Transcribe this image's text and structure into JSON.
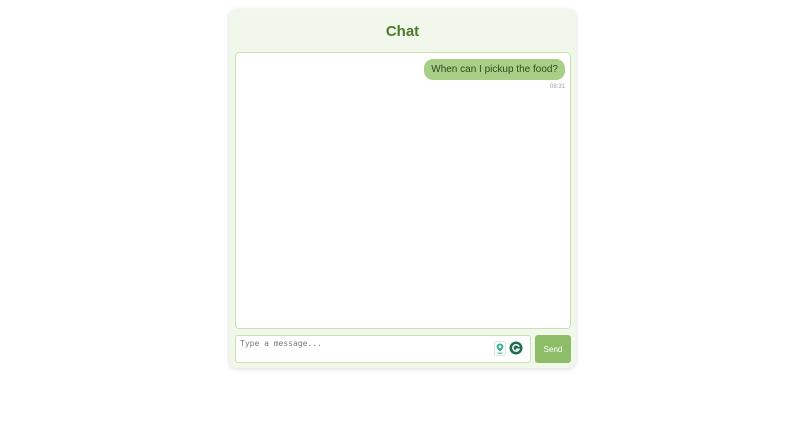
{
  "header": {
    "title": "Chat"
  },
  "messages": [
    {
      "text": "When can I pickup the food?",
      "time": "08:31",
      "sender": "self"
    }
  ],
  "composer": {
    "placeholder": "Type a message...",
    "value": "",
    "send_label": "Send"
  },
  "extensions": [
    {
      "icon": "location-pin-icon"
    },
    {
      "icon": "grammarly-icon"
    }
  ],
  "colors": {
    "accent": "#8dbd66",
    "bubble": "#a8cf86",
    "title": "#4a7a2c",
    "card_bg": "#f1f7ea",
    "border": "#c8e1b2"
  }
}
